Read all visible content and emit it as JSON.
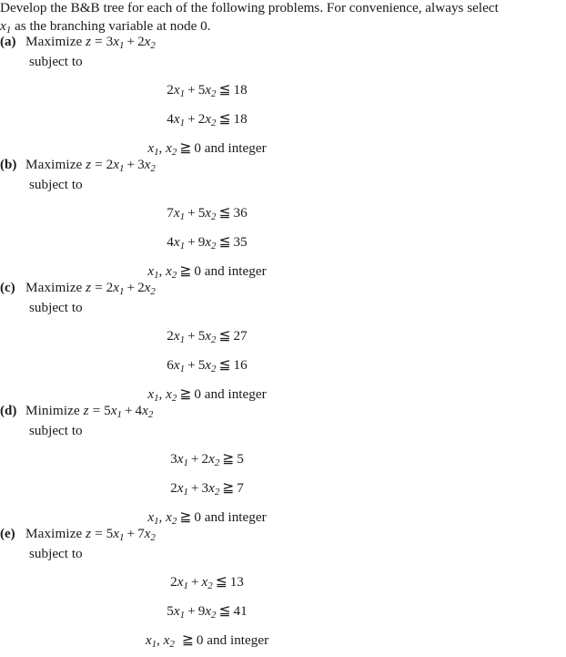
{
  "document": {
    "type": "textbook-exercise",
    "background_color": "#ffffff",
    "text_color": "#1a1a1a"
  },
  "intro": {
    "line1": "Develop the B&B tree for each of the following problems. For convenience, always select",
    "line2_prefix": "x",
    "line2_sub": "1",
    "line2_rest": " as the branching variable at node 0."
  },
  "labels": {
    "subject_to": "subject to",
    "nonnegativity_suffix": "0 and integer",
    "var1": "x",
    "var1_sub": "1",
    "var2": "x",
    "var2_sub": "2",
    "comma": ",",
    "ge": "≧",
    "le": "≦",
    "plus": "+",
    "equals": "=",
    "z": "z"
  },
  "problems": [
    {
      "tag": "(a)",
      "objective_verb": "Maximize",
      "objective": {
        "lhs": "z",
        "terms": [
          {
            "coef": "3",
            "var": "x",
            "sub": "1"
          },
          {
            "coef": "2",
            "var": "x",
            "sub": "2"
          }
        ]
      },
      "constraints": [
        {
          "terms": [
            {
              "coef": "2",
              "var": "x",
              "sub": "1"
            },
            {
              "coef": "5",
              "var": "x",
              "sub": "2"
            }
          ],
          "rel": "≦",
          "rhs": "18"
        },
        {
          "terms": [
            {
              "coef": "4",
              "var": "x",
              "sub": "1"
            },
            {
              "coef": "2",
              "var": "x",
              "sub": "2"
            }
          ],
          "rel": "≦",
          "rhs": "18"
        }
      ],
      "nonnegativity": {
        "rel": "≧",
        "rhs": "0 and integer",
        "extra_gap": false
      }
    },
    {
      "tag": "(b)",
      "objective_verb": "Maximize",
      "objective": {
        "lhs": "z",
        "terms": [
          {
            "coef": "2",
            "var": "x",
            "sub": "1"
          },
          {
            "coef": "3",
            "var": "x",
            "sub": "2"
          }
        ]
      },
      "constraints": [
        {
          "terms": [
            {
              "coef": "7",
              "var": "x",
              "sub": "1"
            },
            {
              "coef": "5",
              "var": "x",
              "sub": "2"
            }
          ],
          "rel": "≦",
          "rhs": "36"
        },
        {
          "terms": [
            {
              "coef": "4",
              "var": "x",
              "sub": "1"
            },
            {
              "coef": "9",
              "var": "x",
              "sub": "2"
            }
          ],
          "rel": "≦",
          "rhs": "35"
        }
      ],
      "nonnegativity": {
        "rel": "≧",
        "rhs": "0 and integer",
        "extra_gap": false
      }
    },
    {
      "tag": "(c)",
      "objective_verb": "Maximize",
      "objective": {
        "lhs": "z",
        "terms": [
          {
            "coef": "2",
            "var": "x",
            "sub": "1"
          },
          {
            "coef": "2",
            "var": "x",
            "sub": "2"
          }
        ]
      },
      "constraints": [
        {
          "terms": [
            {
              "coef": "2",
              "var": "x",
              "sub": "1"
            },
            {
              "coef": "5",
              "var": "x",
              "sub": "2"
            }
          ],
          "rel": "≦",
          "rhs": "27"
        },
        {
          "terms": [
            {
              "coef": "6",
              "var": "x",
              "sub": "1"
            },
            {
              "coef": "5",
              "var": "x",
              "sub": "2"
            }
          ],
          "rel": "≦",
          "rhs": "16"
        }
      ],
      "nonnegativity": {
        "rel": "≧",
        "rhs": "0 and integer",
        "extra_gap": false
      }
    },
    {
      "tag": "(d)",
      "objective_verb": "Minimize",
      "objective": {
        "lhs": "z",
        "terms": [
          {
            "coef": "5",
            "var": "x",
            "sub": "1"
          },
          {
            "coef": "4",
            "var": "x",
            "sub": "2"
          }
        ]
      },
      "constraints": [
        {
          "terms": [
            {
              "coef": "3",
              "var": "x",
              "sub": "1"
            },
            {
              "coef": "2",
              "var": "x",
              "sub": "2"
            }
          ],
          "rel": "≧",
          "rhs": "5"
        },
        {
          "terms": [
            {
              "coef": "2",
              "var": "x",
              "sub": "1"
            },
            {
              "coef": "3",
              "var": "x",
              "sub": "2"
            }
          ],
          "rel": "≧",
          "rhs": "7"
        }
      ],
      "nonnegativity": {
        "rel": "≧",
        "rhs": "0 and integer",
        "extra_gap": false
      }
    },
    {
      "tag": "(e)",
      "objective_verb": "Maximize",
      "objective": {
        "lhs": "z",
        "terms": [
          {
            "coef": "5",
            "var": "x",
            "sub": "1"
          },
          {
            "coef": "7",
            "var": "x",
            "sub": "2"
          }
        ]
      },
      "constraints": [
        {
          "terms": [
            {
              "coef": "2",
              "var": "x",
              "sub": "1"
            },
            {
              "coef": "",
              "var": "x",
              "sub": "2"
            }
          ],
          "rel": "≦",
          "rhs": "13"
        },
        {
          "terms": [
            {
              "coef": "5",
              "var": "x",
              "sub": "1"
            },
            {
              "coef": "9",
              "var": "x",
              "sub": "2"
            }
          ],
          "rel": "≦",
          "rhs": "41"
        }
      ],
      "nonnegativity": {
        "rel": "≧",
        "rhs": "0 and integer",
        "extra_gap": true
      }
    }
  ]
}
